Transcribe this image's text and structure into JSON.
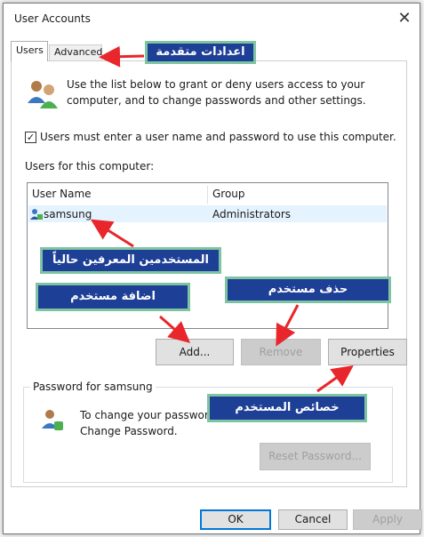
{
  "window": {
    "title": "User Accounts",
    "close_glyph": "✕"
  },
  "tabs": {
    "users": "Users",
    "advanced": "Advanced"
  },
  "intro": "Use the list below to grant or deny users access to your computer, and to change passwords and other settings.",
  "checkbox": {
    "checked": true,
    "glyph": "✓",
    "label": "Users must enter a user name and password to use this computer."
  },
  "users_label": "Users for this computer:",
  "table": {
    "headers": [
      "User Name",
      "Group"
    ],
    "rows": [
      {
        "user": "samsung",
        "group": "Administrators"
      }
    ]
  },
  "buttons": {
    "add": "Add...",
    "remove": "Remove",
    "properties": "Properties",
    "reset_password": "Reset Password...",
    "ok": "OK",
    "cancel": "Cancel",
    "apply": "Apply"
  },
  "password_group": {
    "legend": "Password for samsung",
    "text_line1": "To change your passwor",
    "text_line2": "Change Password."
  },
  "callouts": {
    "advanced": "اعدادات متقدمة",
    "current_users": "المستخدمين المعرفين حالياً",
    "add_user": "اضافة مستخدم",
    "remove_user": "حذف مستخدم",
    "properties": "خصائص المستخدم"
  },
  "colors": {
    "callout_bg": "#1e3f96",
    "callout_border": "#7fc4a2",
    "arrow": "#e8262b",
    "selection": "#e5f3ff"
  }
}
